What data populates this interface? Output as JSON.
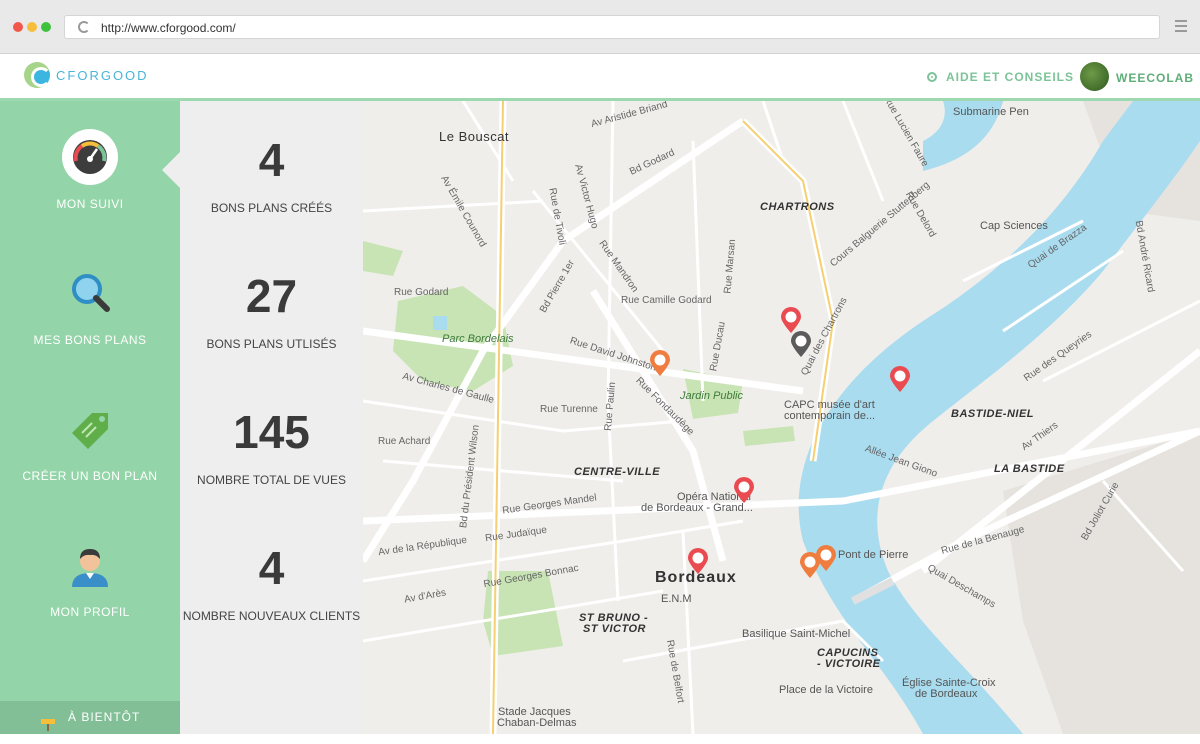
{
  "browser": {
    "url": "http://www.cforgood.com/"
  },
  "header": {
    "logo_text": "CFORGOOD",
    "help_label": "AIDE ET CONSEILS",
    "user_name": "WEECOLAB"
  },
  "sidebar": {
    "items": [
      {
        "label": "MON SUIVI",
        "icon": "dashboard-gauge-icon",
        "active": true
      },
      {
        "label": "MES BONS PLANS",
        "icon": "magnifier-icon",
        "active": false
      },
      {
        "label": "CRÉER UN BON PLAN",
        "icon": "price-tag-icon",
        "active": false
      },
      {
        "label": "MON PROFIL",
        "icon": "user-icon",
        "active": false
      }
    ],
    "footer_label": "À BIENTÔT",
    "footer_icon": "signpost-icon"
  },
  "stats": [
    {
      "value": "4",
      "label": "BONS PLANS CRÉÉS"
    },
    {
      "value": "27",
      "label": "BONS PLANS UTLISÉS"
    },
    {
      "value": "145",
      "label": "NOMBRE TOTAL DE VUES"
    },
    {
      "value": "4",
      "label": "NOMBRE NOUVEAUX CLIENTS"
    }
  ],
  "map": {
    "places": {
      "le_bouscat": "Le Bouscat",
      "chartrons": "CHARTRONS",
      "cap_sciences": "Cap Sciences",
      "submarine": "Submarine Pen",
      "parc_bordelais": "Parc Bordelais",
      "jardin_public": "Jardin Public",
      "capc_1": "CAPC musée d'art",
      "capc_2": "contemporain de...",
      "bastide_niel": "BASTIDE-NIEL",
      "la_bastide": "LA BASTIDE",
      "centre_ville": "CENTRE-VILLE",
      "opera_1": "Opéra National",
      "opera_2": "de Bordeaux - Grand...",
      "bordeaux": "Bordeaux",
      "enm": "E.N.M",
      "pont_de_pierre": "Pont de Pierre",
      "st_bruno_1": "ST BRUNO -",
      "st_bruno_2": "ST VICTOR",
      "basilique": "Basilique Saint-Michel",
      "capucins_1": "CAPUCINS",
      "capucins_2": "- VICTOIRE",
      "place_victoire": "Place de la Victoire",
      "eglise_1": "Église Sainte-Croix",
      "eglise_2": "de Bordeaux",
      "stade_1": "Stade Jacques",
      "stade_2": "Chaban-Delmas"
    },
    "streets": {
      "s1": "Rue Godard",
      "s2": "Av Charles de Gaulle",
      "s3": "Rue Camille Godard",
      "s4": "Rue David Johnston",
      "s5": "Rue Turenne",
      "s6": "Rue Georges Mandel",
      "s7": "Rue Judaïque",
      "s8": "Av de la République",
      "s9": "Rue Georges Bonnac",
      "s10": "Av d'Arès",
      "s11": "Bd du Président Wilson",
      "s12": "Quai des Chartrons",
      "s13": "Cours Balguerie Stuttenberg",
      "s14": "Quai de Brazza",
      "s15": "Rue des Queyries",
      "s16": "Av Thiers",
      "s17": "Rue de la Benauge",
      "s18": "Quai Deschamps",
      "s19": "Bd Joliot Curie",
      "s20": "Allée Jean Giono",
      "s21": "Av Aristide Briand",
      "s22": "Rue Fondaudège",
      "s23": "Rue Ducau",
      "s24": "Rue de Belfort",
      "s25": "Rue Mandron",
      "s26": "Bd Godard",
      "s27": "Bd Pierre 1er",
      "s28": "Rue Achard",
      "s29": "Av Victor Hugo",
      "s30": "Rue de Tivoli",
      "s31": "Rue Lucien Faure",
      "s32": "Rue Delord",
      "s33": "Av Émile Counord",
      "s34": "Rue Paulin",
      "s35": "Bd André Ricard",
      "s36": "Rue Marsan"
    }
  },
  "colors": {
    "sidebar_green": "#93d4a8",
    "accent_green": "#7cc497",
    "logo_blue": "#4ab5d8",
    "river_blue": "#a9dcef",
    "pin_red": "#e94b50",
    "pin_orange": "#ef7d3f",
    "pin_gray": "#5b5b5b"
  }
}
